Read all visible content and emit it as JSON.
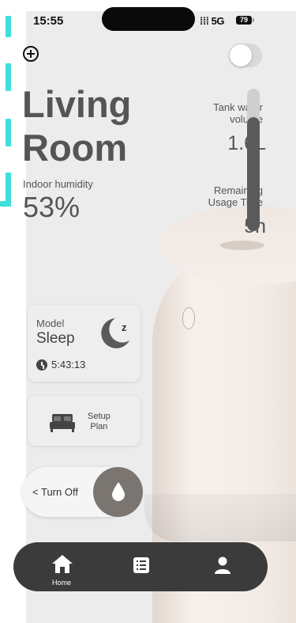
{
  "status_bar": {
    "time": "15:55",
    "signal": "5G",
    "battery": "79"
  },
  "room": {
    "line1": "Living",
    "line2": "Room"
  },
  "humidity": {
    "label": "Indoor humidity",
    "value": "53%"
  },
  "tank": {
    "label_line1": "Tank water",
    "label_line2": "volume",
    "value": "1.6L",
    "level_fraction": 0.8
  },
  "usage": {
    "label_line1": "Remaining",
    "label_line2": "Usage Time",
    "value": "5h"
  },
  "model_card": {
    "label": "Model",
    "value": "Sleep",
    "timer": "5:43:13"
  },
  "setup_card": {
    "line1": "Setup",
    "line2": "Plan"
  },
  "power": {
    "label": "Turn Off"
  },
  "nav": {
    "home_label": "Home",
    "items": [
      "home-icon",
      "list-icon",
      "profile-icon"
    ]
  },
  "colors": {
    "accent_dashes": "#3fe0dc",
    "nav_bg": "#3b3b3b",
    "drop_button": "#7a7570"
  }
}
